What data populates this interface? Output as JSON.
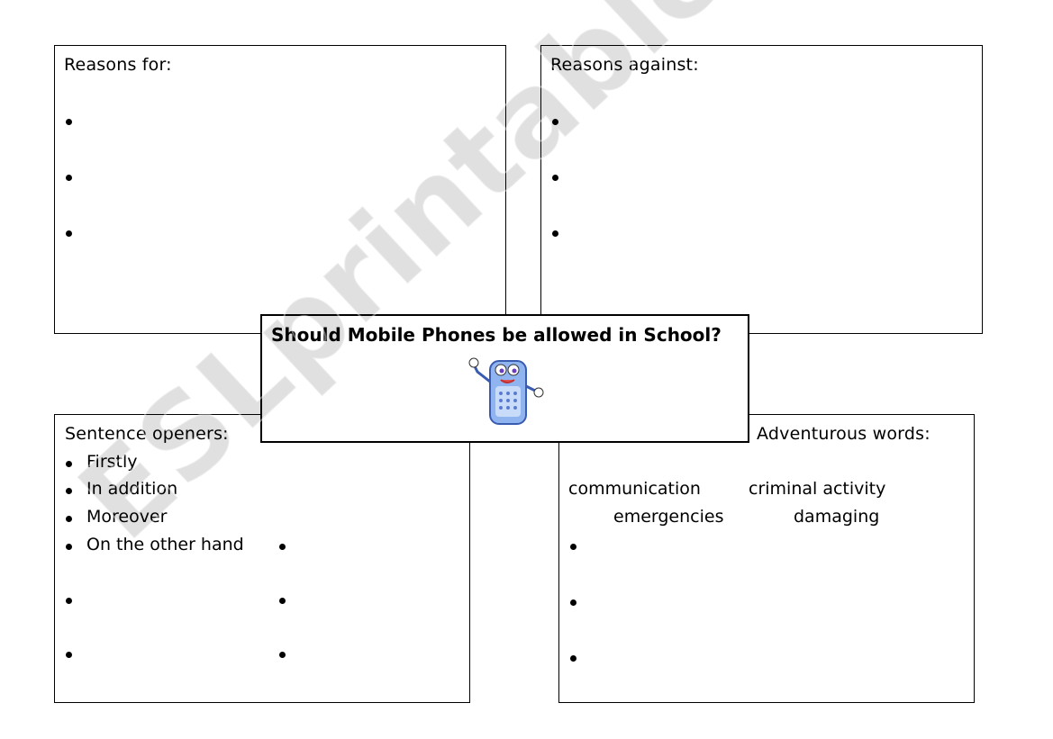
{
  "worksheet": {
    "title": "Should Mobile Phones be allowed in School?",
    "watermark": "ESLprintables.com",
    "boxes": {
      "reasons_for": {
        "label": "Reasons for:",
        "bullets": 3
      },
      "reasons_against": {
        "label": "Reasons against:",
        "bullets": 3
      },
      "sentence_openers": {
        "label": "Sentence openers:",
        "items": [
          "Firstly",
          "In addition",
          "Moreover",
          "On the other hand"
        ]
      },
      "adventurous_words": {
        "label": "Adventurous words:",
        "words": [
          "communication",
          "criminal activity",
          "emergencies",
          "damaging"
        ]
      }
    },
    "image": {
      "icon": "cartoon-mobile-phone-icon"
    }
  }
}
